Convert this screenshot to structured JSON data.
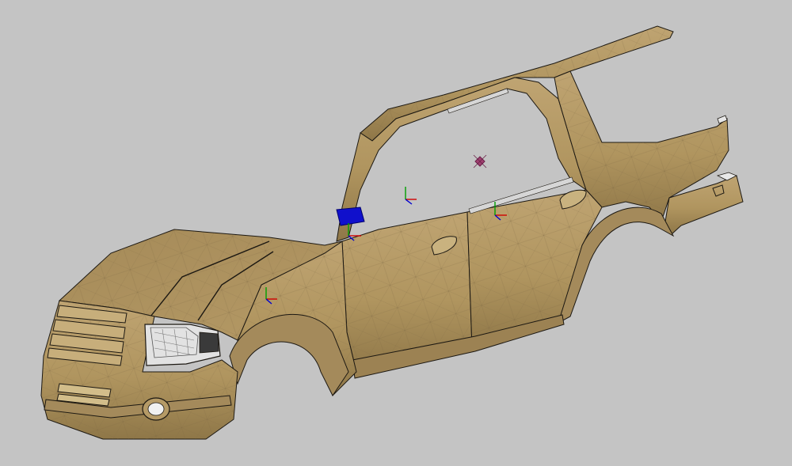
{
  "scene": {
    "background_color": "#c4c4c4",
    "body_color": "#b59a66",
    "body_shadow_color": "#8f7748",
    "edge_color": "#1c1812",
    "mesh_color": "#7d6a45",
    "glass_color": "#d6d6d6",
    "hud_block_color": "#1010cc",
    "axis_colors": {
      "x": "#d00000",
      "y": "#00a000",
      "z": "#0000d0"
    },
    "target_marker_color": "#a04070",
    "icons": [
      "coordinate-axis-icon",
      "target-marker-icon"
    ]
  }
}
